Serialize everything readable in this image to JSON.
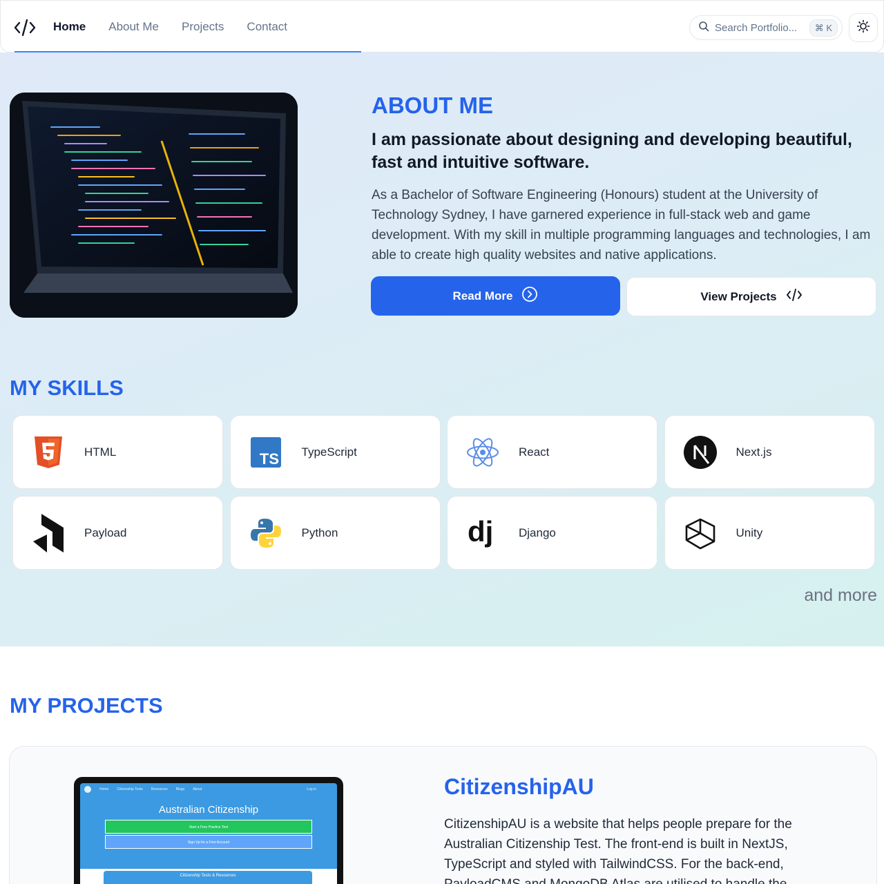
{
  "nav": {
    "links": [
      "Home",
      "About Me",
      "Projects",
      "Contact"
    ],
    "search_placeholder": "Search Portfolio...",
    "search_shortcut": "⌘ K"
  },
  "about": {
    "eyebrow": "ABOUT ME",
    "headline": "I am passionate about designing and developing beautiful, fast and intuitive software.",
    "body": "As a Bachelor of Software Engineering (Honours) student at the University of Technology Sydney, I have garnered experience in full-stack web and game development. With my skill in multiple programming languages and technologies, I am able to create high quality websites and native applications.",
    "read_more": "Read More",
    "view_projects": "View Projects"
  },
  "skills": {
    "title": "MY SKILLS",
    "items": [
      {
        "label": "HTML",
        "icon": "html5-icon"
      },
      {
        "label": "TypeScript",
        "icon": "typescript-icon"
      },
      {
        "label": "React",
        "icon": "react-icon"
      },
      {
        "label": "Next.js",
        "icon": "nextjs-icon"
      },
      {
        "label": "Payload",
        "icon": "payload-icon"
      },
      {
        "label": "Python",
        "icon": "python-icon"
      },
      {
        "label": "Django",
        "icon": "django-icon"
      },
      {
        "label": "Unity",
        "icon": "unity-icon"
      }
    ],
    "and_more": "and more"
  },
  "projects": {
    "title": "MY PROJECTS",
    "items": [
      {
        "name": "CitizenshipAU",
        "description": "CitizenshipAU is a website that helps people prepare for the Australian Citizenship Test. The front-end is built in NextJS, TypeScript and styled with TailwindCSS. For the back-end, PayloadCMS and MongoDB Atlas are utilised to handle the",
        "screenshot": {
          "nav": [
            "Home",
            "Citizenship Tests",
            "Resources",
            "Blogs",
            "About",
            "Log in"
          ],
          "title": "Australian Citizenship",
          "btn_primary": "Start a Free Practice Test",
          "btn_secondary": "Sign Up for a Free Account",
          "panel_title": "Citizenship Tests & Resources"
        }
      }
    ]
  },
  "colors": {
    "accent": "#2563eb",
    "hero_bg_start": "#dfe9f8",
    "hero_bg_end": "#d6f0ef"
  }
}
